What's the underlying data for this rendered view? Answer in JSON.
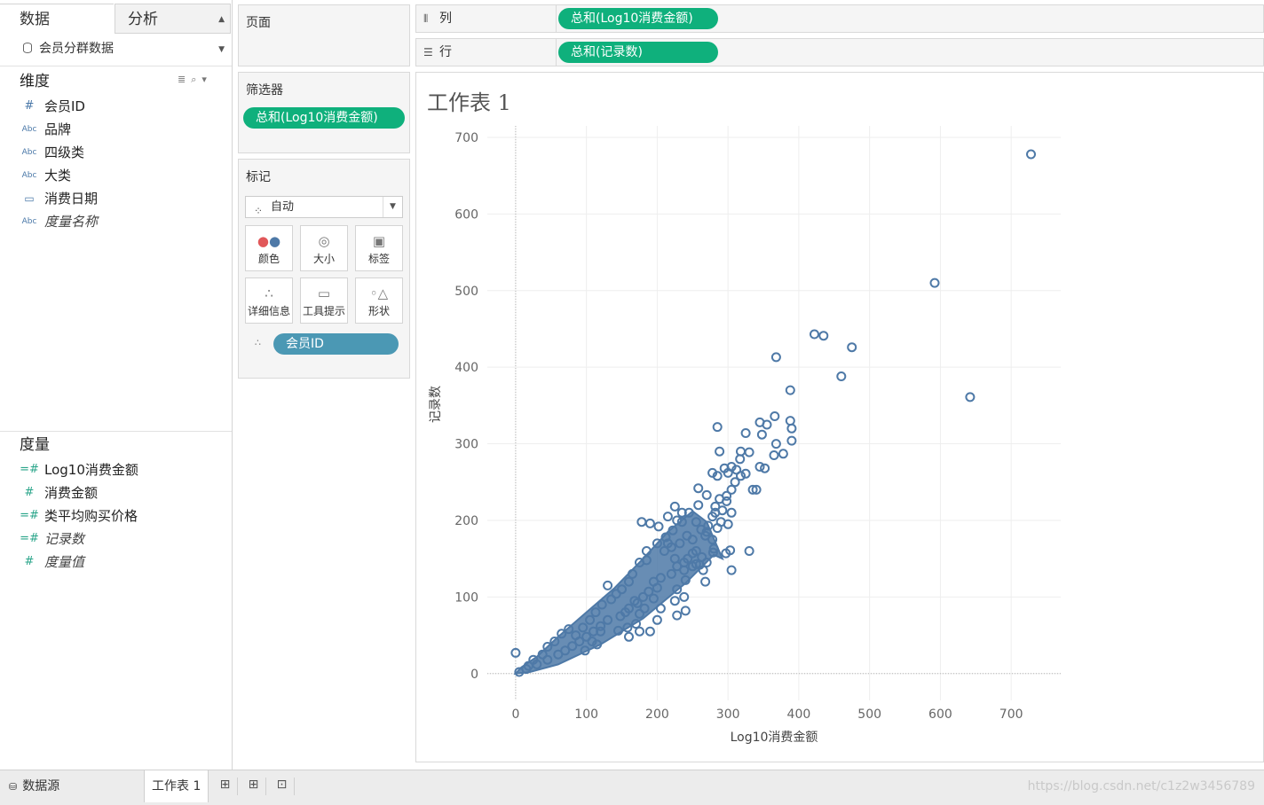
{
  "left_pane": {
    "tabs": [
      {
        "label": "数据"
      },
      {
        "label": "分析"
      }
    ],
    "datasource": "会员分群数据",
    "dimensions_title": "维度",
    "dimensions": [
      {
        "label": "会员ID",
        "icon": "#"
      },
      {
        "label": "品牌",
        "icon": "Abc"
      },
      {
        "label": "四级类",
        "icon": "Abc"
      },
      {
        "label": "大类",
        "icon": "Abc"
      },
      {
        "label": "消费日期",
        "icon": "calendar"
      },
      {
        "label": "度量名称",
        "icon": "Abc"
      }
    ],
    "measures_title": "度量",
    "measures": [
      {
        "label": "Log10消费金额",
        "icon": "=#"
      },
      {
        "label": "消费金额",
        "icon": "#"
      },
      {
        "label": "类平均购买价格",
        "icon": "=#"
      },
      {
        "label": "记录数",
        "icon": "=#"
      },
      {
        "label": "度量值",
        "icon": "#"
      }
    ]
  },
  "pages_card": {
    "title": "页面"
  },
  "filters_card": {
    "title": "筛选器",
    "pill": "总和(Log10消费金额)"
  },
  "marks_card": {
    "title": "标记",
    "mark_type": "自动",
    "buttons": [
      "颜色",
      "大小",
      "标签",
      "详细信息",
      "工具提示",
      "形状"
    ],
    "pill": "会员ID"
  },
  "shelves": {
    "columns": {
      "label": "列",
      "pill": "总和(Log10消费金额)"
    },
    "rows": {
      "label": "行",
      "pill": "总和(记录数)"
    }
  },
  "sheet": {
    "title": "工作表 1"
  },
  "chart_data": {
    "type": "scatter",
    "xlabel": "Log10消费金额",
    "ylabel": "记录数",
    "xlim": [
      -40,
      770
    ],
    "ylim": [
      -35,
      715
    ],
    "xticks": [
      0,
      100,
      200,
      300,
      400,
      500,
      600,
      700
    ],
    "yticks": [
      0,
      100,
      200,
      300,
      400,
      500,
      600,
      700
    ],
    "grid": true,
    "marker": "open-circle",
    "color": "#4e79a7",
    "series": [
      {
        "points": [
          [
            728,
            678
          ],
          [
            592,
            510
          ],
          [
            642,
            361
          ],
          [
            422,
            443
          ],
          [
            435,
            441
          ],
          [
            475,
            426
          ],
          [
            460,
            388
          ],
          [
            368,
            413
          ],
          [
            388,
            370
          ],
          [
            366,
            336
          ],
          [
            388,
            330
          ],
          [
            390,
            320
          ],
          [
            390,
            304
          ],
          [
            368,
            300
          ],
          [
            345,
            328
          ],
          [
            355,
            325
          ],
          [
            348,
            312
          ],
          [
            325,
            314
          ],
          [
            285,
            322
          ],
          [
            288,
            290
          ],
          [
            378,
            287
          ],
          [
            318,
            290
          ],
          [
            330,
            289
          ],
          [
            317,
            280
          ],
          [
            365,
            285
          ],
          [
            345,
            270
          ],
          [
            352,
            268
          ],
          [
            305,
            270
          ],
          [
            312,
            266
          ],
          [
            318,
            258
          ],
          [
            325,
            261
          ],
          [
            295,
            268
          ],
          [
            300,
            262
          ],
          [
            310,
            250
          ],
          [
            278,
            262
          ],
          [
            298,
            232
          ],
          [
            285,
            258
          ],
          [
            305,
            240
          ],
          [
            298,
            225
          ],
          [
            335,
            240
          ],
          [
            340,
            240
          ],
          [
            258,
            242
          ],
          [
            270,
            233
          ],
          [
            288,
            228
          ],
          [
            225,
            218
          ],
          [
            235,
            210
          ],
          [
            245,
            210
          ],
          [
            282,
            218
          ],
          [
            282,
            210
          ],
          [
            258,
            220
          ],
          [
            292,
            213
          ],
          [
            278,
            205
          ],
          [
            290,
            198
          ],
          [
            300,
            195
          ],
          [
            305,
            210
          ],
          [
            255,
            198
          ],
          [
            262,
            188
          ],
          [
            270,
            185
          ],
          [
            268,
            180
          ],
          [
            285,
            190
          ],
          [
            272,
            193
          ],
          [
            278,
            175
          ],
          [
            242,
            180
          ],
          [
            250,
            175
          ],
          [
            232,
            170
          ],
          [
            220,
            165
          ],
          [
            210,
            160
          ],
          [
            215,
            170
          ],
          [
            255,
            160
          ],
          [
            225,
            150
          ],
          [
            238,
            145
          ],
          [
            228,
            140
          ],
          [
            220,
            130
          ],
          [
            205,
            125
          ],
          [
            195,
            120
          ],
          [
            200,
            112
          ],
          [
            188,
            107
          ],
          [
            180,
            100
          ],
          [
            172,
            92
          ],
          [
            160,
            85
          ],
          [
            155,
            80
          ],
          [
            148,
            75
          ],
          [
            130,
            70
          ],
          [
            120,
            62
          ],
          [
            110,
            55
          ],
          [
            100,
            48
          ],
          [
            90,
            42
          ],
          [
            80,
            36
          ],
          [
            70,
            30
          ],
          [
            60,
            25
          ],
          [
            45,
            18
          ],
          [
            30,
            12
          ],
          [
            15,
            6
          ],
          [
            5,
            2
          ],
          [
            0,
            27
          ],
          [
            250,
            157
          ],
          [
            279,
            158
          ],
          [
            297,
            157
          ],
          [
            280,
            163
          ],
          [
            270,
            145
          ],
          [
            263,
            152
          ],
          [
            255,
            143
          ],
          [
            303,
            161
          ],
          [
            330,
            160
          ],
          [
            305,
            135
          ],
          [
            238,
            135
          ],
          [
            228,
            110
          ],
          [
            238,
            100
          ],
          [
            185,
            148
          ],
          [
            178,
            198
          ],
          [
            190,
            196
          ],
          [
            215,
            205
          ],
          [
            222,
            187
          ],
          [
            202,
            192
          ],
          [
            228,
            200
          ],
          [
            235,
            198
          ],
          [
            260,
            142
          ],
          [
            268,
            120
          ],
          [
            240,
            122
          ],
          [
            250,
            140
          ],
          [
            265,
            135
          ],
          [
            243,
            150
          ],
          [
            225,
            95
          ],
          [
            205,
            85
          ],
          [
            195,
            98
          ],
          [
            182,
            85
          ],
          [
            175,
            78
          ],
          [
            168,
            95
          ],
          [
            150,
            110
          ],
          [
            142,
            104
          ],
          [
            130,
            115
          ],
          [
            120,
            55
          ],
          [
            108,
            42
          ],
          [
            95,
            60
          ],
          [
            85,
            50
          ],
          [
            75,
            58
          ],
          [
            65,
            52
          ],
          [
            55,
            42
          ],
          [
            45,
            35
          ],
          [
            38,
            25
          ],
          [
            25,
            18
          ],
          [
            18,
            10
          ],
          [
            190,
            55
          ],
          [
            240,
            82
          ],
          [
            228,
            76
          ],
          [
            200,
            70
          ],
          [
            170,
            65
          ],
          [
            158,
            60
          ],
          [
            145,
            56
          ],
          [
            105,
            70
          ],
          [
            113,
            80
          ],
          [
            122,
            90
          ],
          [
            135,
            97
          ],
          [
            160,
            120
          ],
          [
            165,
            130
          ],
          [
            175,
            145
          ],
          [
            185,
            160
          ],
          [
            200,
            170
          ],
          [
            212,
            178
          ],
          [
            175,
            55
          ],
          [
            160,
            48
          ],
          [
            115,
            38
          ],
          [
            98,
            30
          ]
        ]
      }
    ]
  },
  "bottom_bar": {
    "datasource_tab": "数据源",
    "sheet_tab": "工作表 1",
    "watermark": "https://blog.csdn.net/c1z2w3456789"
  }
}
